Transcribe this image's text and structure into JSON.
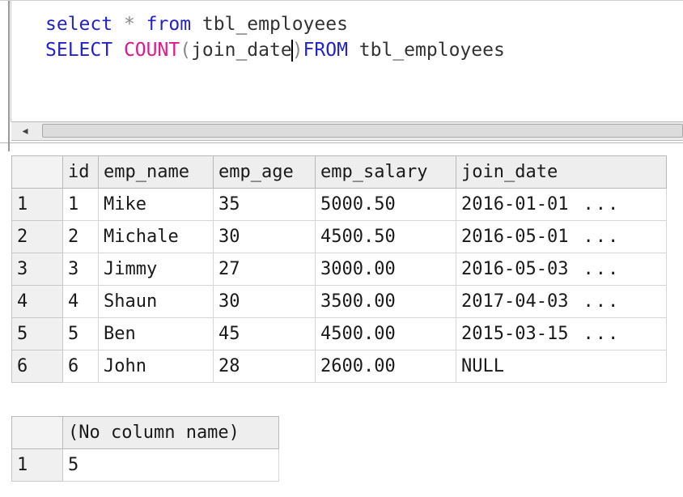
{
  "editor": {
    "line1": {
      "select": "select",
      "star": "*",
      "from": "from",
      "table": "tbl_employees"
    },
    "line2": {
      "select": "SELECT",
      "count": "COUNT",
      "open_paren": "(",
      "arg": "join_date",
      "close_paren": ")",
      "from": "FROM",
      "table": "tbl_employees"
    }
  },
  "scrollbar": {
    "left_arrow": "◂"
  },
  "results1": {
    "columns": [
      "id",
      "emp_name",
      "emp_age",
      "emp_salary",
      "join_date"
    ],
    "rows": [
      {
        "num": "1",
        "id": "1",
        "emp_name": "Mike",
        "emp_age": "35",
        "emp_salary": "5000.50",
        "join_date": "2016-01-01",
        "more": "..."
      },
      {
        "num": "2",
        "id": "2",
        "emp_name": "Michale",
        "emp_age": "30",
        "emp_salary": "4500.50",
        "join_date": "2016-05-01",
        "more": "..."
      },
      {
        "num": "3",
        "id": "3",
        "emp_name": "Jimmy",
        "emp_age": "27",
        "emp_salary": "3000.00",
        "join_date": "2016-05-03",
        "more": "..."
      },
      {
        "num": "4",
        "id": "4",
        "emp_name": "Shaun",
        "emp_age": "30",
        "emp_salary": "3500.00",
        "join_date": "2017-04-03",
        "more": "..."
      },
      {
        "num": "5",
        "id": "5",
        "emp_name": "Ben",
        "emp_age": "45",
        "emp_salary": "4500.00",
        "join_date": "2015-03-15",
        "more": "..."
      },
      {
        "num": "6",
        "id": "6",
        "emp_name": "John",
        "emp_age": "28",
        "emp_salary": "2600.00",
        "join_date": "NULL",
        "more": ""
      }
    ]
  },
  "results2": {
    "columns": [
      "(No column name)"
    ],
    "rows": [
      {
        "num": "1",
        "value": "5"
      }
    ]
  }
}
